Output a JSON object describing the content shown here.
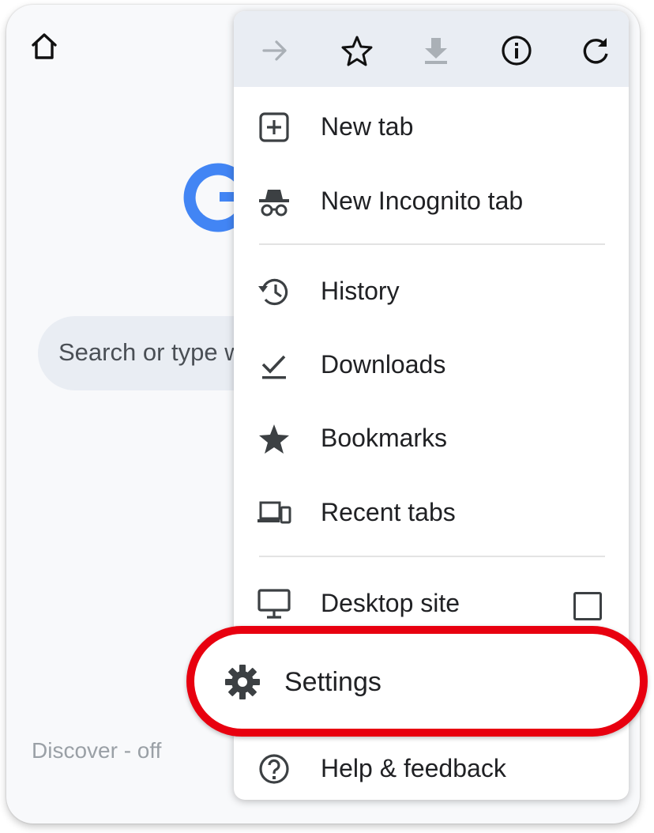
{
  "background_page": {
    "home_icon": "home-icon",
    "search_placeholder": "Search or type w",
    "discover_status": "Discover - off"
  },
  "menu": {
    "toolbar": {
      "icons": [
        "forward-icon",
        "star-icon",
        "download-icon",
        "info-icon",
        "refresh-icon"
      ]
    },
    "items": [
      {
        "label": "New tab",
        "icon": "new-tab-icon"
      },
      {
        "label": "New Incognito tab",
        "icon": "incognito-icon"
      },
      {
        "label": "History",
        "icon": "history-icon"
      },
      {
        "label": "Downloads",
        "icon": "downloads-icon"
      },
      {
        "label": "Bookmarks",
        "icon": "bookmarks-star-icon"
      },
      {
        "label": "Recent tabs",
        "icon": "recent-tabs-icon"
      },
      {
        "label": "Desktop site",
        "icon": "desktop-icon",
        "checked": false
      },
      {
        "label": "Settings",
        "icon": "gear-icon",
        "highlighted": true
      },
      {
        "label": "Help & feedback",
        "icon": "help-icon"
      }
    ]
  },
  "colors": {
    "highlight_ring": "#e8000f",
    "toolbar_bg": "#e9edf3",
    "google_blue": "#4285f4"
  }
}
